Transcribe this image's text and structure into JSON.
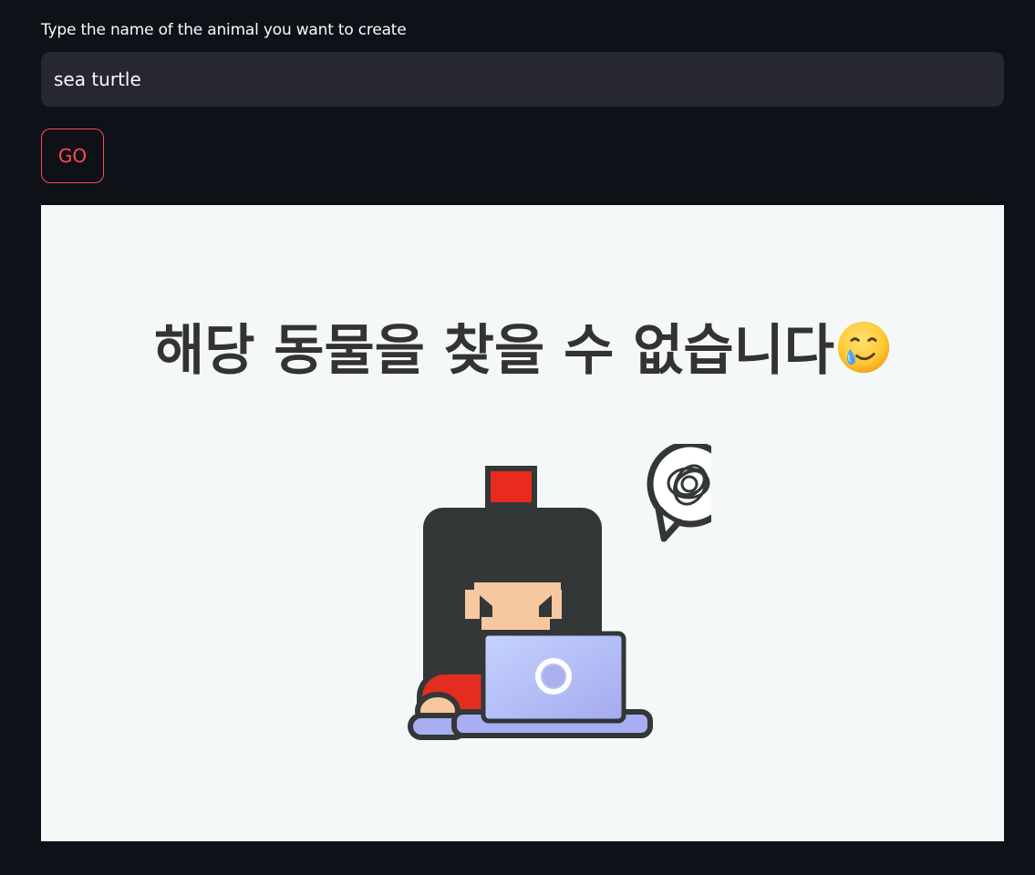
{
  "form": {
    "label": "Type the name of the animal you want to create",
    "input_value": "sea turtle",
    "go_label": "GO"
  },
  "result": {
    "message": "해당 동물을 찾을 수 없습니다",
    "message_emoji_icon": "smiling-face-with-tear-icon",
    "illustration_icon": "confused-person-at-laptop-icon"
  },
  "colors": {
    "background": "#0e1117",
    "input_background": "#262730",
    "accent": "#ff4b4b",
    "panel_background": "#f5f8f8",
    "text_dark": "#333333"
  }
}
